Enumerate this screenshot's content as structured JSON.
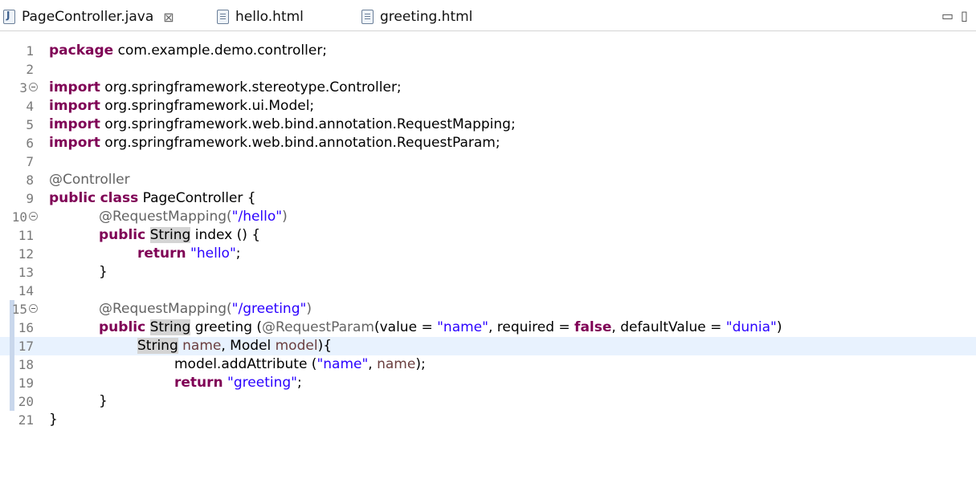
{
  "tabs": [
    {
      "label": "PageController.java",
      "icon": "java-file-icon",
      "active": true,
      "close": "⊠"
    },
    {
      "label": "hello.html",
      "icon": "html-file-icon",
      "active": false
    },
    {
      "label": "greeting.html",
      "icon": "html-file-icon",
      "active": false
    }
  ],
  "window_controls": {
    "minimize": "▭",
    "maximize": "▯"
  },
  "code": {
    "line_numbers": [
      "1",
      "2",
      "3",
      "4",
      "5",
      "6",
      "7",
      "8",
      "9",
      "10",
      "11",
      "12",
      "13",
      "14",
      "15",
      "16",
      "17",
      "18",
      "19",
      "20",
      "21"
    ],
    "l1": {
      "kw": "package",
      "rest": " com.example.demo.controller;"
    },
    "l3": {
      "kw": "import",
      "rest": " org.springframework.stereotype.Controller;"
    },
    "l4": {
      "kw": "import",
      "rest": " org.springframework.ui.Model;"
    },
    "l5": {
      "kw": "import",
      "rest": " org.springframework.web.bind.annotation.RequestMapping;"
    },
    "l6": {
      "kw": "import",
      "rest": " org.springframework.web.bind.annotation.RequestParam;"
    },
    "l8": {
      "ann": "@Controller"
    },
    "l9": {
      "kw1": "public",
      "kw2": "class",
      "rest": " PageController {"
    },
    "l10": {
      "ann": "@RequestMapping(",
      "str": "\"/hello\"",
      "end": ")"
    },
    "l11": {
      "kw": "public",
      "type": "String",
      "rest": " index () {"
    },
    "l12": {
      "kw": "return",
      "str": "\"hello\"",
      "end": ";"
    },
    "l13": {
      "text": "}"
    },
    "l15": {
      "ann": "@RequestMapping(",
      "str": "\"/greeting\"",
      "end": ")"
    },
    "l16": {
      "kw": "public",
      "type": "String",
      "mid": " greeting (",
      "ann": "@RequestParam",
      "p1": "(value = ",
      "s1": "\"name\"",
      "p2": ", required = ",
      "kwfalse": "false",
      "p3": ", defaultValue = ",
      "s2": "\"dunia\"",
      "end": ")"
    },
    "l17": {
      "type": "String",
      "p1": "name",
      "mid": ", Model ",
      "p2": "model",
      "end": "){"
    },
    "l18": {
      "a": "model.addAttribute (",
      "str": "\"name\"",
      "b": ", ",
      "param": "name",
      "end": ");"
    },
    "l19": {
      "kw": "return",
      "str": "\"greeting\"",
      "end": ";"
    },
    "l20": {
      "text": "}"
    },
    "l21": {
      "text": "}"
    }
  }
}
